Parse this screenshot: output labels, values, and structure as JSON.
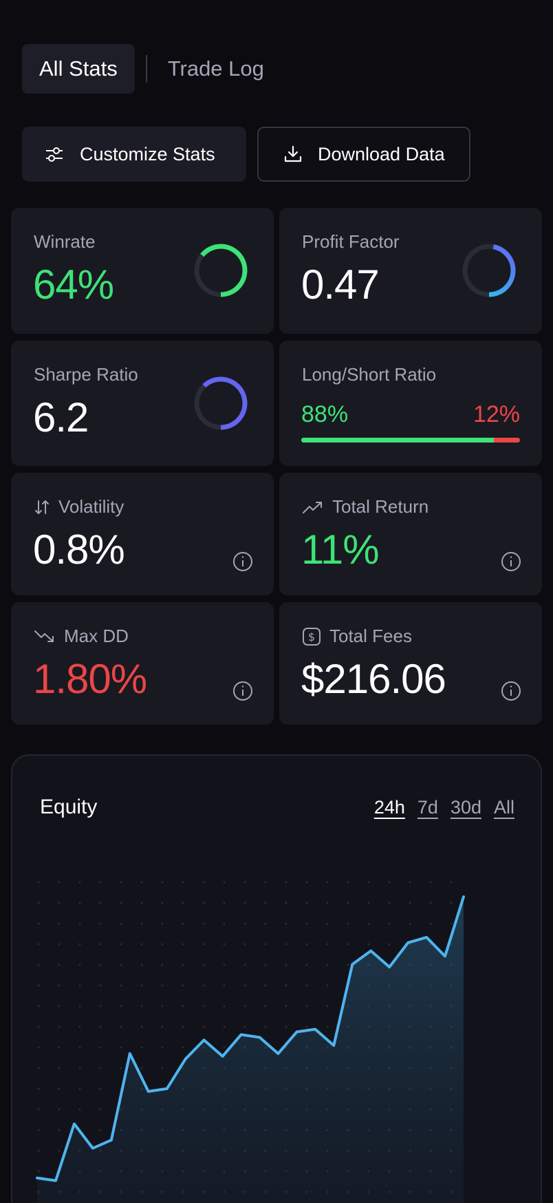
{
  "tabs": [
    {
      "label": "All Stats",
      "active": true
    },
    {
      "label": "Trade Log",
      "active": false
    }
  ],
  "toolbar": {
    "customize_label": "Customize Stats",
    "download_label": "Download Data"
  },
  "stats": {
    "winrate": {
      "label": "Winrate",
      "value": "64%",
      "ring_fraction": 0.64,
      "ring_color": "#3ee276"
    },
    "profit_factor": {
      "label": "Profit Factor",
      "value": "0.47",
      "ring_fraction": 0.47,
      "ring_color_start": "#22d3ee",
      "ring_color_end": "#6366f1"
    },
    "sharpe": {
      "label": "Sharpe Ratio",
      "value": "6.2",
      "ring_fraction": 0.62,
      "ring_color": "#6366f1"
    },
    "long_short": {
      "label": "Long/Short Ratio",
      "long": "88%",
      "short": "12%",
      "long_fraction": 0.88
    },
    "volatility": {
      "label": "Volatility",
      "value": "0.8%",
      "icon": "arrows-up-down-icon"
    },
    "total_return": {
      "label": "Total Return",
      "value": "11%",
      "icon": "trending-up-icon"
    },
    "max_dd": {
      "label": "Max DD",
      "value": "1.80%",
      "icon": "trending-down-icon"
    },
    "total_fees": {
      "label": "Total Fees",
      "value": "$216.06",
      "icon": "dollar-icon"
    }
  },
  "colors": {
    "green": "#3ee276",
    "red": "#ec4646",
    "line": "#4fb4ee",
    "muted": "#a4a6b5"
  },
  "equity": {
    "title": "Equity",
    "ranges": [
      {
        "label": "24h",
        "active": true
      },
      {
        "label": "7d",
        "active": false
      },
      {
        "label": "30d",
        "active": false
      },
      {
        "label": "All",
        "active": false
      }
    ]
  },
  "chart_data": {
    "type": "area",
    "title": "Equity",
    "x": [
      0,
      1,
      2,
      3,
      4,
      5,
      6,
      7,
      8,
      9,
      10,
      11,
      12,
      13,
      14,
      15,
      16,
      17,
      18,
      19,
      20,
      21,
      22,
      23
    ],
    "values": [
      7,
      6,
      27,
      18,
      21,
      53,
      39,
      40,
      51,
      58,
      52,
      60,
      59,
      53,
      61,
      62,
      56,
      86,
      91,
      85,
      94,
      96,
      89,
      111
    ],
    "ylim": [
      -15,
      125
    ],
    "grid": "dots"
  }
}
